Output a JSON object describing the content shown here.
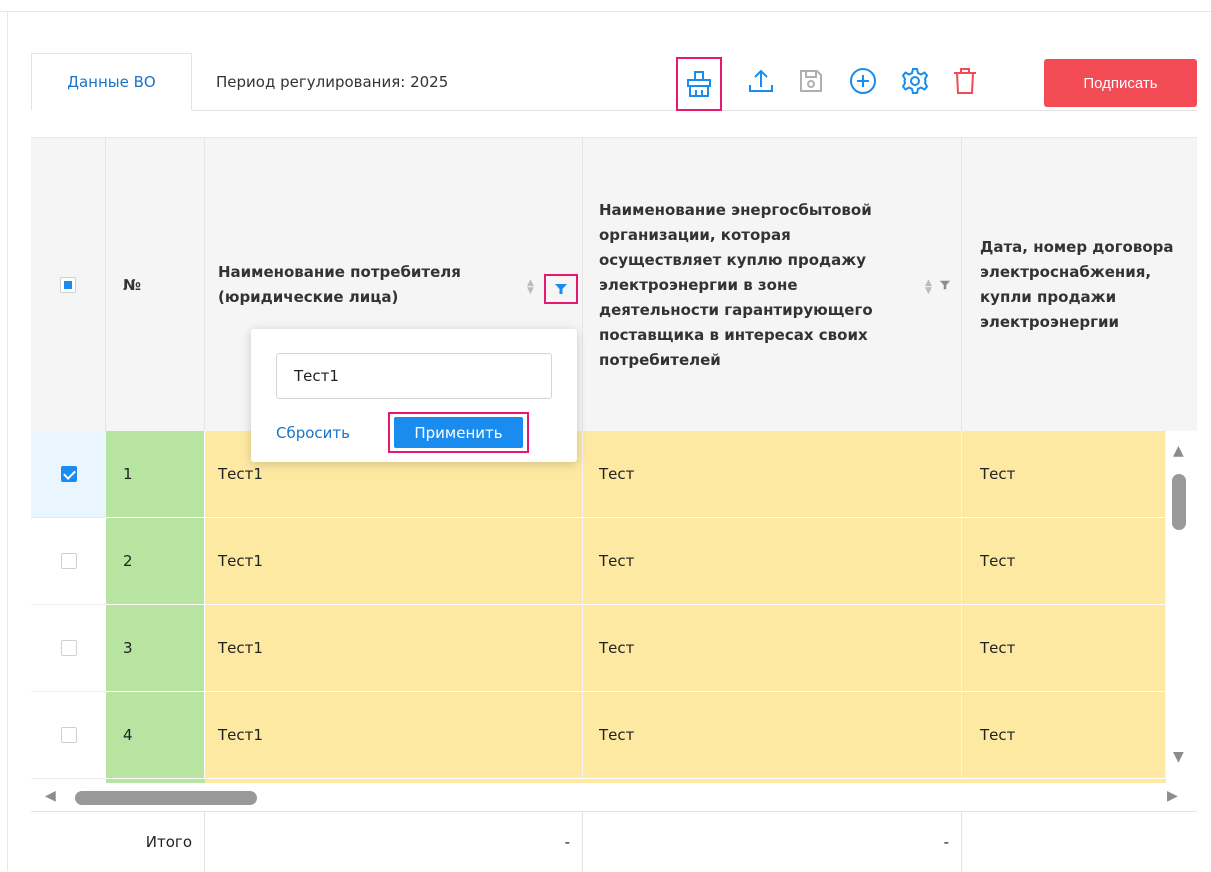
{
  "tabs": [
    {
      "label": "Данные ВО"
    },
    {
      "label": "Период регулирования: 2025"
    }
  ],
  "toolbar": {
    "icons": [
      "broom-icon",
      "upload-icon",
      "save-icon",
      "add-circle-icon",
      "settings-icon",
      "trash-icon"
    ],
    "sign_label": "Подписать",
    "accent": "#1a8cf0",
    "sign_color": "#f24b55"
  },
  "table": {
    "columns": [
      {
        "label": "№"
      },
      {
        "label": "Наименование потребителя (юридические лица)"
      },
      {
        "label": "Наименование энергосбытовой организации, которая осуществляет куплю продажу электроэнергии в зоне деятельности гарантирующего поставщика в интересах своих потребителей"
      },
      {
        "label": "Дата, номер договора электроснабжения, купли продажи электроэнергии"
      }
    ],
    "rows": [
      {
        "num": "1",
        "consumer": "Тест1",
        "org": "Тест",
        "contract": "Тест",
        "selected": true
      },
      {
        "num": "2",
        "consumer": "Тест1",
        "org": "Тест",
        "contract": "Тест",
        "selected": false
      },
      {
        "num": "3",
        "consumer": "Тест1",
        "org": "Тест",
        "contract": "Тест",
        "selected": false
      },
      {
        "num": "4",
        "consumer": "Тест1",
        "org": "Тест",
        "contract": "Тест",
        "selected": false
      }
    ],
    "total": {
      "label": "Итого",
      "col1": "-",
      "col2": "-"
    }
  },
  "filter_popup": {
    "value": "Тест1",
    "reset_label": "Сбросить",
    "apply_label": "Применить"
  }
}
